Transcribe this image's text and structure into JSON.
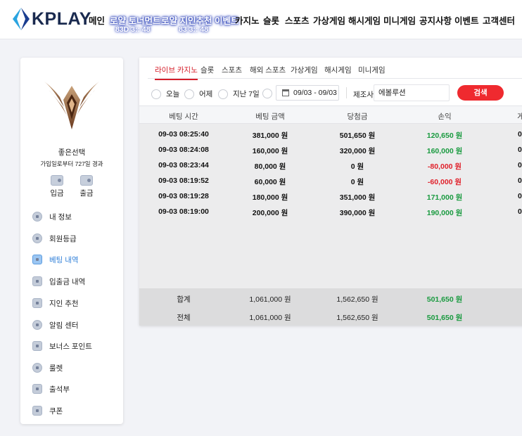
{
  "header": {
    "logo_text": "KPLAY",
    "nav": [
      {
        "label": "메인",
        "sub": ""
      },
      {
        "label": "로얄 토너먼트",
        "sub": "83D 3:: 48"
      },
      {
        "label": "로얄 지인추천 이벤트",
        "sub": "83 3:: 48"
      },
      {
        "label": "카지노",
        "sub": ""
      },
      {
        "label": "슬롯",
        "sub": ""
      },
      {
        "label": "스포츠",
        "sub": ""
      },
      {
        "label": "가상게임",
        "sub": ""
      },
      {
        "label": "해시게임",
        "sub": ""
      },
      {
        "label": "미니게임",
        "sub": ""
      },
      {
        "label": "공지사항",
        "sub": ""
      },
      {
        "label": "이벤트",
        "sub": ""
      },
      {
        "label": "고객센터",
        "sub": ""
      }
    ]
  },
  "profile": {
    "username": "좋은선택",
    "joined": "가입일로부터 727일 경과",
    "deposit_label": "입금",
    "withdraw_label": "출금"
  },
  "menu": [
    {
      "label": "내 정보",
      "icon": "user-icon",
      "active": false
    },
    {
      "label": "회원등급",
      "icon": "badge-icon",
      "active": false
    },
    {
      "label": "베팅 내역",
      "icon": "document-icon",
      "active": true
    },
    {
      "label": "입출금 내역",
      "icon": "wallet-icon",
      "active": false
    },
    {
      "label": "지인 추천",
      "icon": "gift-icon",
      "active": false
    },
    {
      "label": "알림 센터",
      "icon": "chat-icon",
      "active": false
    },
    {
      "label": "보너스 포인트",
      "icon": "coin-icon",
      "active": false
    },
    {
      "label": "룰렛",
      "icon": "roulette-icon",
      "active": false
    },
    {
      "label": "출석부",
      "icon": "checklist-icon",
      "active": false
    },
    {
      "label": "쿠폰",
      "icon": "coupon-icon",
      "active": false
    }
  ],
  "tabs": [
    "라이브 카지노",
    "슬롯",
    "스포츠",
    "해외 스포츠",
    "가상게임",
    "해시게임",
    "미니게임"
  ],
  "filter": {
    "periods": [
      "오늘",
      "어제",
      "지난 7일"
    ],
    "date_range": "09/03 - 09/03",
    "provider_label": "제조사:",
    "provider_value": "에볼루션",
    "search_label": "검색"
  },
  "table": {
    "columns": [
      "베팅 시간",
      "베팅 금액",
      "당첨금",
      "손익",
      "게"
    ],
    "rows": [
      {
        "time": "09-03 08:25:40",
        "bet": "381,000 원",
        "win": "501,650 원",
        "pl": "120,650 원",
        "pl_sign": "pos",
        "extra": "0"
      },
      {
        "time": "09-03 08:24:08",
        "bet": "160,000 원",
        "win": "320,000 원",
        "pl": "160,000 원",
        "pl_sign": "pos",
        "extra": "0"
      },
      {
        "time": "09-03 08:23:44",
        "bet": "80,000 원",
        "win": "0 원",
        "pl": "-80,000 원",
        "pl_sign": "neg",
        "extra": "0"
      },
      {
        "time": "09-03 08:19:52",
        "bet": "60,000 원",
        "win": "0 원",
        "pl": "-60,000 원",
        "pl_sign": "neg",
        "extra": "0"
      },
      {
        "time": "09-03 08:19:28",
        "bet": "180,000 원",
        "win": "351,000 원",
        "pl": "171,000 원",
        "pl_sign": "pos",
        "extra": "0"
      },
      {
        "time": "09-03 08:19:00",
        "bet": "200,000 원",
        "win": "390,000 원",
        "pl": "190,000 원",
        "pl_sign": "pos",
        "extra": "0"
      }
    ],
    "totals": [
      {
        "label": "합계",
        "bet": "1,061,000 원",
        "win": "1,562,650 원",
        "pl": "501,650 원"
      },
      {
        "label": "전체",
        "bet": "1,061,000 원",
        "win": "1,562,650 원",
        "pl": "501,650 원"
      }
    ]
  },
  "colors": {
    "accent": "#ef2a2f",
    "positive": "#199a3f",
    "negative": "#e0212b",
    "active_menu": "#2f7fd8"
  }
}
